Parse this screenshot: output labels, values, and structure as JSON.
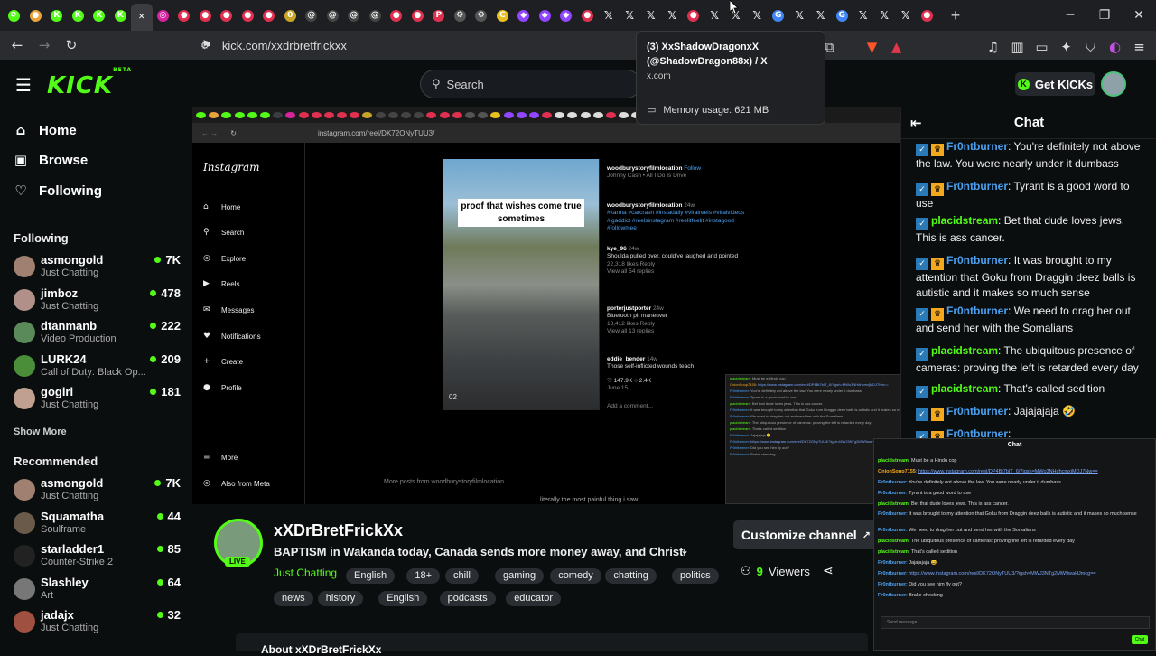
{
  "browser": {
    "url": "kick.com/xxdrbretfrickxx",
    "tooltip": {
      "title_line1": "(3) XxShadowDragonxX",
      "title_line2": "(@ShadowDragon88x) / X",
      "domain": "x.com",
      "memory": "Memory usage: 621 MB"
    },
    "tab_favicons": [
      {
        "icon": "circle-icon",
        "color": "#53fc18",
        "glyph": "⟳"
      },
      {
        "icon": "chrome-icon",
        "color": "#e8a33b",
        "glyph": "●"
      },
      {
        "icon": "kick-icon",
        "color": "#53fc18",
        "glyph": "K"
      },
      {
        "icon": "kick-icon",
        "color": "#53fc18",
        "glyph": "K"
      },
      {
        "icon": "kick-icon",
        "color": "#53fc18",
        "glyph": "K"
      },
      {
        "icon": "kick-icon",
        "color": "#53fc18",
        "glyph": "K"
      },
      {
        "icon": "close-icon",
        "color": "#3a3c40",
        "glyph": "✕"
      },
      {
        "icon": "instagram-icon",
        "color": "#d6249f",
        "glyph": "◎"
      },
      {
        "icon": "youtube-icon",
        "color": "#e03050",
        "glyph": "●"
      },
      {
        "icon": "youtube-icon",
        "color": "#e03050",
        "glyph": "●"
      },
      {
        "icon": "youtube-icon",
        "color": "#e03050",
        "glyph": "●"
      },
      {
        "icon": "youtube-icon",
        "color": "#e03050",
        "glyph": "●"
      },
      {
        "icon": "youtube-icon",
        "color": "#e03050",
        "glyph": "●"
      },
      {
        "icon": "circle-icon",
        "color": "#c9a527",
        "glyph": "0"
      },
      {
        "icon": "threads-icon",
        "color": "#444",
        "glyph": "@"
      },
      {
        "icon": "threads-icon",
        "color": "#444",
        "glyph": "@"
      },
      {
        "icon": "threads-icon",
        "color": "#444",
        "glyph": "@"
      },
      {
        "icon": "threads-icon",
        "color": "#444",
        "glyph": "@"
      },
      {
        "icon": "youtube-icon",
        "color": "#e03050",
        "glyph": "●"
      },
      {
        "icon": "youtube-icon",
        "color": "#e03050",
        "glyph": "●"
      },
      {
        "icon": "pinterest-icon",
        "color": "#e03050",
        "glyph": "P"
      },
      {
        "icon": "settings-icon",
        "color": "#555",
        "glyph": "⚙"
      },
      {
        "icon": "settings-icon",
        "color": "#555",
        "glyph": "⚙"
      },
      {
        "icon": "circle-icon",
        "color": "#e8c020",
        "glyph": "C"
      },
      {
        "icon": "twitch-icon",
        "color": "#9146ff",
        "glyph": "◆"
      },
      {
        "icon": "twitch-icon",
        "color": "#9146ff",
        "glyph": "◆"
      },
      {
        "icon": "twitch-icon",
        "color": "#9146ff",
        "glyph": "◆"
      },
      {
        "icon": "youtube-icon",
        "color": "#e03050",
        "glyph": "●"
      },
      {
        "icon": "x-icon",
        "color": "x",
        "glyph": "𝕏"
      },
      {
        "icon": "x-icon",
        "color": "x",
        "glyph": "𝕏"
      },
      {
        "icon": "x-icon",
        "color": "x",
        "glyph": "𝕏"
      },
      {
        "icon": "x-icon",
        "color": "x",
        "glyph": "𝕏"
      },
      {
        "icon": "youtube-icon",
        "color": "#e03050",
        "glyph": "●"
      },
      {
        "icon": "x-icon",
        "color": "x",
        "glyph": "𝕏"
      },
      {
        "icon": "x-icon",
        "color": "x",
        "glyph": "𝕏"
      },
      {
        "icon": "x-icon",
        "color": "x",
        "glyph": "𝕏"
      },
      {
        "icon": "google-icon",
        "color": "#4285f4",
        "glyph": "G"
      },
      {
        "icon": "x-icon",
        "color": "x",
        "glyph": "𝕏"
      },
      {
        "icon": "x-icon",
        "color": "x",
        "glyph": "𝕏"
      },
      {
        "icon": "google-icon",
        "color": "#4285f4",
        "glyph": "G"
      },
      {
        "icon": "x-icon",
        "color": "x",
        "glyph": "𝕏"
      },
      {
        "icon": "x-icon",
        "color": "x",
        "glyph": "𝕏"
      },
      {
        "icon": "x-icon",
        "color": "x",
        "glyph": "𝕏"
      },
      {
        "icon": "youtube-icon",
        "color": "#e03050",
        "glyph": "●"
      }
    ]
  },
  "site": {
    "logo": "KICK",
    "logo_badge": "BETA",
    "search_placeholder": "Search",
    "get_kicks": "Get KICKs",
    "accent": "#53fc18"
  },
  "sidebar": {
    "nav": [
      {
        "label": "Home",
        "icon": "home-icon",
        "glyph": "⌂"
      },
      {
        "label": "Browse",
        "icon": "browse-icon",
        "glyph": "▣"
      },
      {
        "label": "Following",
        "icon": "heart-icon",
        "glyph": "♡"
      }
    ],
    "following_title": "Following",
    "following": [
      {
        "name": "asmongold",
        "category": "Just Chatting",
        "viewers": "7K",
        "color": "#a08070"
      },
      {
        "name": "jimboz",
        "category": "Just Chatting",
        "viewers": "478",
        "color": "#b09088"
      },
      {
        "name": "dtanmanb",
        "category": "Video Production",
        "viewers": "222",
        "color": "#5a8a5a"
      },
      {
        "name": "LURK24",
        "category": "Call of Duty: Black Op...",
        "viewers": "209",
        "color": "#4b8e3a"
      },
      {
        "name": "gogirl",
        "category": "Just Chatting",
        "viewers": "181",
        "color": "#c0a090"
      }
    ],
    "show_more": "Show More",
    "recommended_title": "Recommended",
    "recommended": [
      {
        "name": "asmongold",
        "category": "Just Chatting",
        "viewers": "7K",
        "color": "#a08070"
      },
      {
        "name": "Squamatha",
        "category": "Soulframe",
        "viewers": "44",
        "color": "#6a5a4a"
      },
      {
        "name": "starladder1",
        "category": "Counter-Strike 2",
        "viewers": "85",
        "color": "#222"
      },
      {
        "name": "Slashley",
        "category": "Art",
        "viewers": "64",
        "color": "#777"
      },
      {
        "name": "jadajx",
        "category": "Just Chatting",
        "viewers": "32",
        "color": "#a05040"
      }
    ]
  },
  "stream_content": {
    "inner_url": "instagram.com/reel/DK72ONyTUU3/",
    "ig_logo": "Instagram",
    "ig_nav": [
      {
        "label": "Home",
        "glyph": "⌂"
      },
      {
        "label": "Search",
        "glyph": "⚲"
      },
      {
        "label": "Explore",
        "glyph": "◎"
      },
      {
        "label": "Reels",
        "glyph": "▶"
      },
      {
        "label": "Messages",
        "glyph": "✉"
      },
      {
        "label": "Notifications",
        "glyph": "♥"
      },
      {
        "label": "Create",
        "glyph": "+"
      },
      {
        "label": "Profile",
        "glyph": "●"
      }
    ],
    "ig_more": "More",
    "ig_also": "Also from Meta",
    "reel_caption": "proof that wishes come true sometimes",
    "reel_counter": "02",
    "ig_author": "woodburystoryfilmlocation",
    "ig_follow": "Follow",
    "ig_song": "Johnny Cash • All I Do Is Drive",
    "ig_post_user": "woodburystoryfilmlocation",
    "ig_post_age": "24w",
    "ig_post_tags": "#karma #carcrash #instadaily #viralreels #viralvideos #igaddict #reelsinstagram #reelitfeelit #instagood #followmee",
    "ig_comments": [
      {
        "user": "kye_96",
        "age": "24w",
        "text": "Shoulda pulled over, could've laughed and pointed",
        "likes": "22,318 likes",
        "reply": "Reply",
        "more": "View all 54 replies"
      },
      {
        "user": "porterjustporter",
        "age": "24w",
        "text": "Bluetooth pit maneuver",
        "likes": "13,412 likes",
        "reply": "Reply",
        "more": "View all 13 replies"
      },
      {
        "user": "eddie_bender",
        "age": "14w",
        "text": "Those self-inflicted wounds teach"
      }
    ],
    "ig_likes": "147.9K",
    "ig_comment_count": "2.4K",
    "ig_date": "June 15",
    "ig_add_comment": "Add a comment...",
    "ig_more_posts": "More posts from woodburystoryfilmlocation",
    "ig_bottom_text": "literally the most painful thing i saw"
  },
  "channel": {
    "name": "xXDrBretFrickXx",
    "live": "LIVE",
    "title": "BAPTISM in Wakanda today, Canada sends more money away, and Christma...",
    "category": "Just Chatting",
    "tags": [
      "English",
      "18+",
      "chill",
      "gaming",
      "comedy",
      "chatting",
      "politics",
      "news",
      "history",
      "English",
      "podcasts",
      "educator"
    ],
    "customize": "Customize channel",
    "viewers": "9",
    "viewers_label": "Viewers",
    "about": "About xXDrBretFrickXx"
  },
  "chat": {
    "title": "Chat",
    "messages": [
      {
        "user": "Fr0ntburner",
        "color": "#4aa0f0",
        "badges": 2,
        "text": "You're definitely not above the law. You were nearly under it dumbass"
      },
      {
        "user": "Fr0ntburner",
        "color": "#4aa0f0",
        "badges": 2,
        "text": "Tyrant is a good word to use"
      },
      {
        "user": "placidstream",
        "color": "#53fc18",
        "badges": 1,
        "text": "Bet that dude loves jews. This is ass cancer."
      },
      {
        "user": "Fr0ntburner",
        "color": "#4aa0f0",
        "badges": 2,
        "text": "It was brought to my attention that Goku from Draggin deez balls is autistic and it makes so much sense"
      },
      {
        "user": "Fr0ntburner",
        "color": "#4aa0f0",
        "badges": 2,
        "text": "We need to drag her out and send her with the Somalians"
      },
      {
        "user": "placidstream",
        "color": "#53fc18",
        "badges": 1,
        "text": "The ubiquitous presence of cameras: proving the left is retarded every day"
      },
      {
        "user": "placidstream",
        "color": "#53fc18",
        "badges": 1,
        "text": "That's called sedition"
      },
      {
        "user": "Fr0ntburner",
        "color": "#4aa0f0",
        "badges": 2,
        "text": "Jajajajaja 🤣"
      },
      {
        "user": "Fr0ntburner",
        "color": "#4aa0f0",
        "badges": 2,
        "text": ""
      }
    ]
  },
  "mirror_chat": {
    "title": "Chat",
    "messages": [
      {
        "user": "placidstream",
        "color": "#53fc18",
        "text": "Must be a Hindu cop",
        "link": ""
      },
      {
        "user": "OnionSoup7155",
        "color": "#f4a81d",
        "text": "",
        "link": "https://www.instagram.com/reel/DP4Bt7bIT_6/?igsh=MWo3NHdhcmxjMDJ7Nw=="
      },
      {
        "user": "Fr0ntburner",
        "color": "#4aa0f0",
        "text": "You're definitely not above the law. You were nearly under it dumbass",
        "link": ""
      },
      {
        "user": "Fr0ntburner",
        "color": "#4aa0f0",
        "text": "Tyrant is a good word to use",
        "link": ""
      },
      {
        "user": "placidstream",
        "color": "#53fc18",
        "text": "Bet that dude loves jews. This is ass cancer.",
        "link": ""
      },
      {
        "user": "Fr0ntburner",
        "color": "#4aa0f0",
        "text": "It was brought to my attention that Goku from Draggin deez balls is autistic and it makes so much sense",
        "link": ""
      },
      {
        "user": "Fr0ntburner",
        "color": "#4aa0f0",
        "text": "We need to drag her out and send her with the Somalians",
        "link": ""
      },
      {
        "user": "placidstream",
        "color": "#53fc18",
        "text": "The ubiquitous presence of cameras: proving the left is retarded every day",
        "link": ""
      },
      {
        "user": "placidstream",
        "color": "#53fc18",
        "text": "That's called sedition",
        "link": ""
      },
      {
        "user": "Fr0ntburner",
        "color": "#4aa0f0",
        "text": "Jajajajaja 😄",
        "link": ""
      },
      {
        "user": "Fr0ntburner",
        "color": "#4aa0f0",
        "text": "",
        "link": "https://www.instagram.com/reel/DK72ONyTUU3/?igsh=MWJ3NTg2MW9waHJmcg=="
      },
      {
        "user": "Fr0ntburner",
        "color": "#4aa0f0",
        "text": "Did you see him fly out?",
        "link": ""
      },
      {
        "user": "Fr0ntburner",
        "color": "#4aa0f0",
        "text": "Brake checking",
        "link": ""
      }
    ],
    "input_placeholder": "Send message...",
    "chat_button": "Chat"
  }
}
